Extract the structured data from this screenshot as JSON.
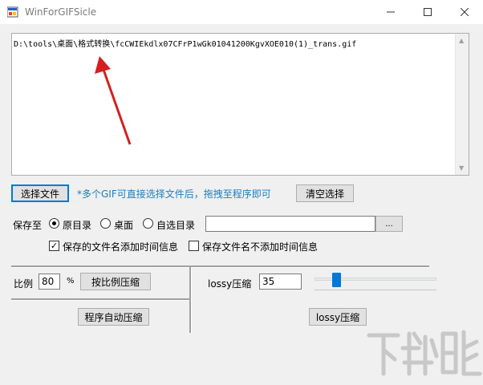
{
  "window": {
    "title": "WinForGIFSicle",
    "controls": {
      "minimize": "—",
      "maximize": "☐",
      "close": "✕"
    }
  },
  "file_list": {
    "path": "D:\\tools\\桌面\\格式转换\\fcCWIEkdlx07CFrP1wGk01041200KgvXOE010(1)_trans.gif"
  },
  "actions": {
    "select_file": "选择文件",
    "hint": "*多个GIF可直接选择文件后，拖拽至程序即可",
    "clear_selection": "清空选择"
  },
  "save": {
    "label": "保存至",
    "options": [
      "原目录",
      "桌面",
      "自选目录"
    ],
    "selected": "原目录",
    "custom_path": "",
    "browse": "...",
    "add_time_label": "保存的文件名添加时间信息",
    "add_time_checked": true,
    "no_time_label": "保存文件名不添加时间信息",
    "no_time_checked": false
  },
  "ratio": {
    "label": "比例",
    "value": "80",
    "unit": "%",
    "button": "按比例压缩",
    "auto_button": "程序自动压缩"
  },
  "lossy": {
    "label": "lossy压缩",
    "value": "35",
    "slider_fraction": 0.15,
    "button": "lossy压缩"
  },
  "watermark": {
    "text": "下载吧"
  },
  "colors": {
    "accent": "#0078d7",
    "hint": "#1a7fbf",
    "arrow": "#d42020"
  }
}
